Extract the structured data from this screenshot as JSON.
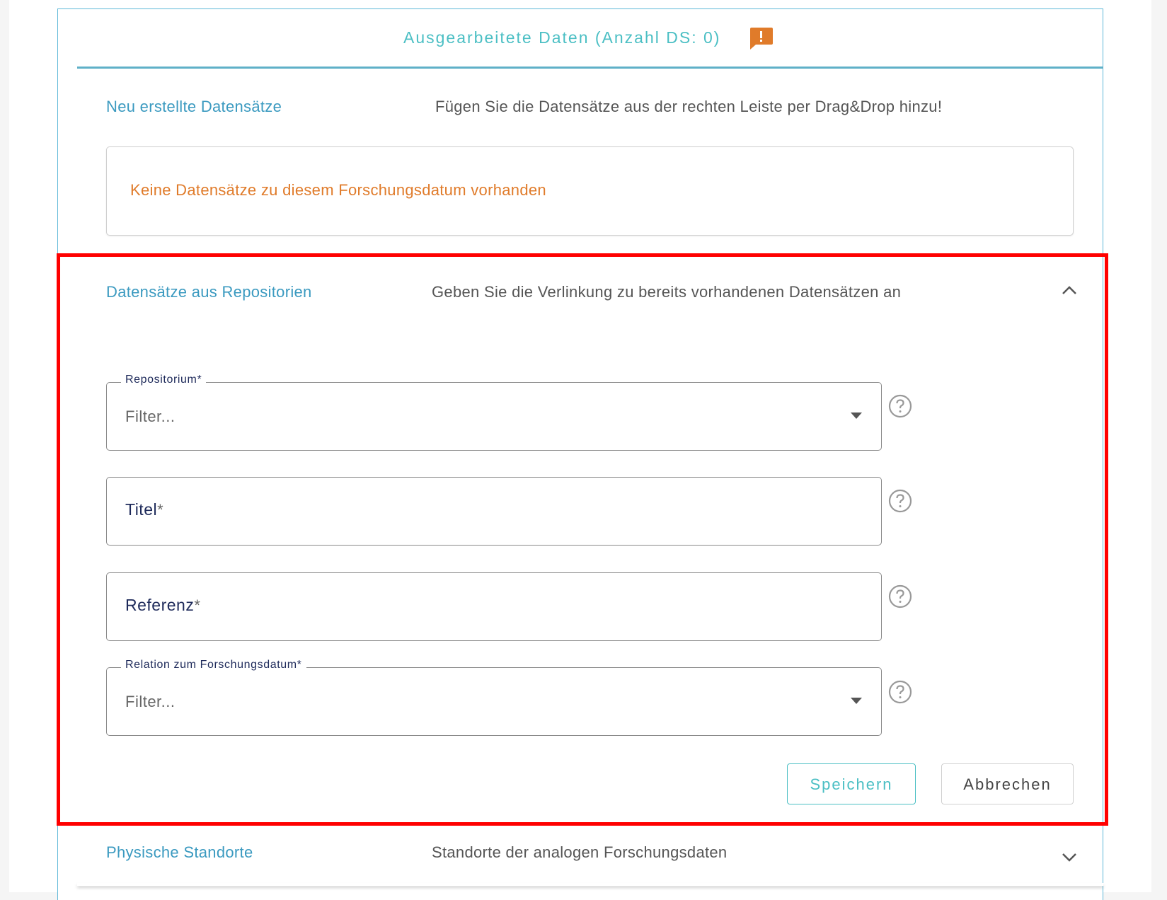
{
  "header": {
    "title": "Ausgearbeitete Daten (Anzahl DS: 0)",
    "alert_icon": "alert-comment-icon",
    "accent_color": "#4bbfc4",
    "alert_color": "#e07b2a"
  },
  "new_records": {
    "title": "Neu erstellte Datensätze",
    "description": "Fügen Sie die Datensätze aus der rechten Leiste per Drag&Drop hinzu!",
    "empty_message": "Keine Datensätze zu diesem Forschungsdatum vorhanden"
  },
  "repo_records": {
    "title": "Datensätze aus Repositorien",
    "description": "Geben Sie die Verlinkung zu bereits vorhandenen Datensätzen an",
    "expanded": true,
    "fields": {
      "repository": {
        "label": "Repositorium*",
        "placeholder": "Filter..."
      },
      "title": {
        "label": "Titel",
        "required_mark": "*"
      },
      "reference": {
        "label": "Referenz",
        "required_mark": "*"
      },
      "relation": {
        "label": "Relation zum Forschungsdatum*",
        "placeholder": "Filter..."
      }
    },
    "buttons": {
      "save": "Speichern",
      "cancel": "Abbrechen"
    }
  },
  "physical_locations": {
    "title": "Physische Standorte",
    "description": "Standorte der analogen Forschungsdaten",
    "expanded": false
  }
}
